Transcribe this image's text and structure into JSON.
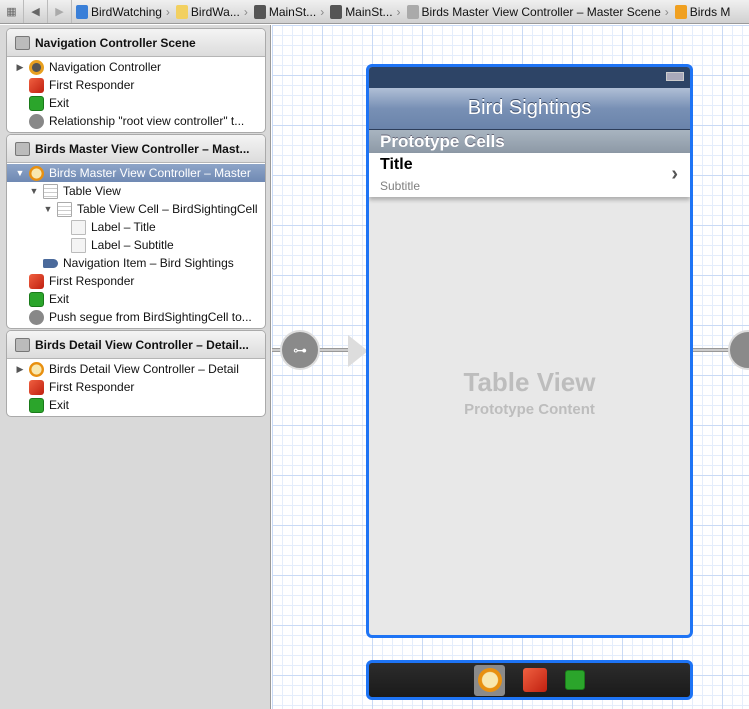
{
  "breadcrumbs": [
    {
      "label": "BirdWatching",
      "icon": "project-icon"
    },
    {
      "label": "BirdWa...",
      "icon": "folder-icon"
    },
    {
      "label": "MainSt...",
      "icon": "storyboard-icon"
    },
    {
      "label": "MainSt...",
      "icon": "storyboard-icon"
    },
    {
      "label": "Birds Master View Controller – Master Scene",
      "icon": "scene-icon"
    },
    {
      "label": "Birds M",
      "icon": "view-controller-icon"
    }
  ],
  "outline": {
    "scenes": [
      {
        "title": "Navigation Controller Scene",
        "items": [
          {
            "label": "Navigation Controller",
            "icon": "navigation-controller-icon",
            "indent": 0,
            "disclosure": "closed"
          },
          {
            "label": "First Responder",
            "icon": "first-responder-icon",
            "indent": 0
          },
          {
            "label": "Exit",
            "icon": "exit-icon",
            "indent": 0
          },
          {
            "label": "Relationship \"root view controller\" t...",
            "icon": "segue-icon",
            "indent": 0
          }
        ]
      },
      {
        "title": "Birds Master View Controller – Mast...",
        "items": [
          {
            "label": "Birds Master View Controller – Master",
            "icon": "view-controller-icon",
            "indent": 0,
            "disclosure": "open",
            "selected": true
          },
          {
            "label": "Table View",
            "icon": "table-view-icon",
            "indent": 1,
            "disclosure": "open"
          },
          {
            "label": "Table View Cell – BirdSightingCell",
            "icon": "table-view-cell-icon",
            "indent": 2,
            "disclosure": "open"
          },
          {
            "label": "Label – Title",
            "icon": "label-icon",
            "indent": 3
          },
          {
            "label": "Label – Subtitle",
            "icon": "label-icon",
            "indent": 3
          },
          {
            "label": "Navigation Item – Bird Sightings",
            "icon": "navigation-item-icon",
            "indent": 1
          },
          {
            "label": "First Responder",
            "icon": "first-responder-icon",
            "indent": 0
          },
          {
            "label": "Exit",
            "icon": "exit-icon",
            "indent": 0
          },
          {
            "label": "Push segue from BirdSightingCell to...",
            "icon": "segue-icon",
            "indent": 0
          }
        ]
      },
      {
        "title": "Birds Detail View Controller – Detail...",
        "items": [
          {
            "label": "Birds Detail View Controller – Detail",
            "icon": "view-controller-icon",
            "indent": 0,
            "disclosure": "closed"
          },
          {
            "label": "First Responder",
            "icon": "first-responder-icon",
            "indent": 0
          },
          {
            "label": "Exit",
            "icon": "exit-icon",
            "indent": 0
          }
        ]
      }
    ]
  },
  "canvas": {
    "nav_title": "Bird Sightings",
    "section_header": "Prototype Cells",
    "cell_title": "Title",
    "cell_subtitle": "Subtitle",
    "table_placeholder_title": "Table View",
    "table_placeholder_subtitle": "Prototype Content",
    "selection_color": "#1e74f5"
  }
}
